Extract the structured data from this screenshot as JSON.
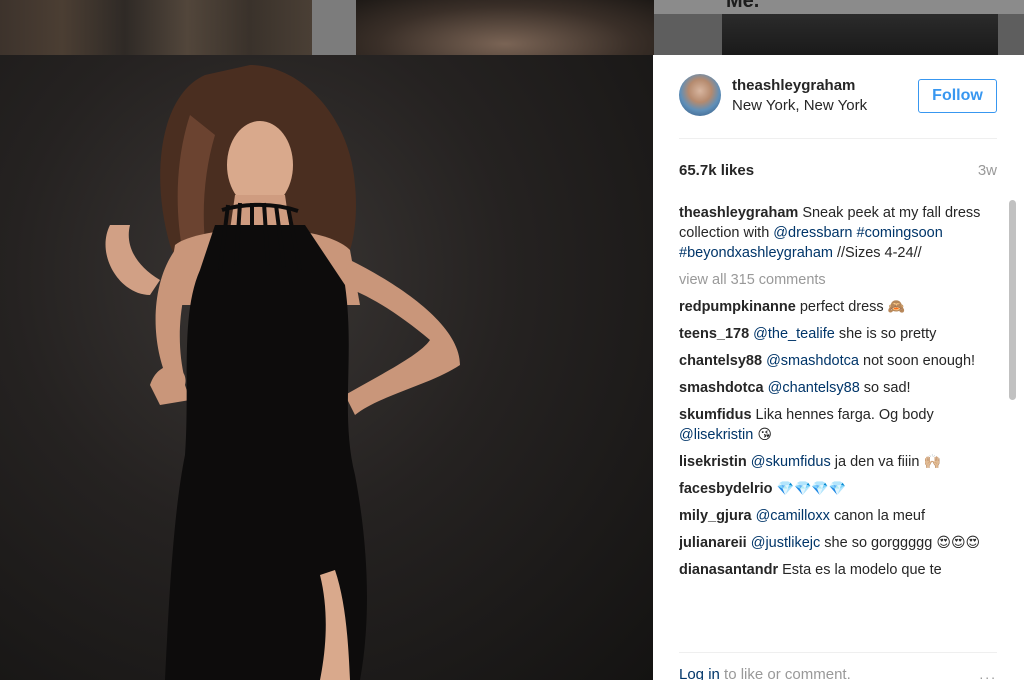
{
  "background": {
    "partial_text": "Me."
  },
  "post": {
    "username": "theashleygraham",
    "location": "New York, New York",
    "follow_label": "Follow",
    "likes": "65.7k likes",
    "age": "3w",
    "caption": {
      "user": "theashleygraham",
      "text1": "Sneak peek at my fall dress collection with",
      "mention": "@dressbarn",
      "tag1": "#comingsoon",
      "tag2": "#beyondxashleygraham",
      "text2": "//Sizes 4-24//"
    },
    "view_all": "view all 315 comments",
    "comments": [
      {
        "user": "redpumpkinanne",
        "pre": "perfect dress",
        "mention": "",
        "post": "",
        "emoji": "🙈"
      },
      {
        "user": "teens_178",
        "pre": "",
        "mention": "@the_tealife",
        "post": "she is so pretty",
        "emoji": ""
      },
      {
        "user": "chantelsy88",
        "pre": "",
        "mention": "@smashdotca",
        "post": "not soon enough!",
        "emoji": ""
      },
      {
        "user": "smashdotca",
        "pre": "",
        "mention": "@chantelsy88",
        "post": "so sad!",
        "emoji": ""
      },
      {
        "user": "skumfidus",
        "pre": "Lika hennes farga. Og body",
        "mention": "@lisekristin",
        "post": "",
        "emoji": "😘"
      },
      {
        "user": "lisekristin",
        "pre": "",
        "mention": "@skumfidus",
        "post": "ja den va fiiin",
        "emoji": "🙌🏼"
      },
      {
        "user": "facesbydelrio",
        "pre": "",
        "mention": "",
        "post": "",
        "emoji": "💎💎💎💎"
      },
      {
        "user": "mily_gjura",
        "pre": "",
        "mention": "@camilloxx",
        "post": "canon la meuf",
        "emoji": ""
      },
      {
        "user": "julianareii",
        "pre": "",
        "mention": "@justlikejc",
        "post": "she so gorggggg",
        "emoji": "😍😍😍"
      },
      {
        "user": "dianasantandr",
        "pre": "Esta es la modelo que te",
        "mention": "",
        "post": "",
        "emoji": ""
      }
    ],
    "footer": {
      "login": "Log in",
      "rest": "to like or comment.",
      "more": "..."
    }
  },
  "colors": {
    "link": "#003569",
    "follow": "#3897f0",
    "muted": "#999999"
  }
}
